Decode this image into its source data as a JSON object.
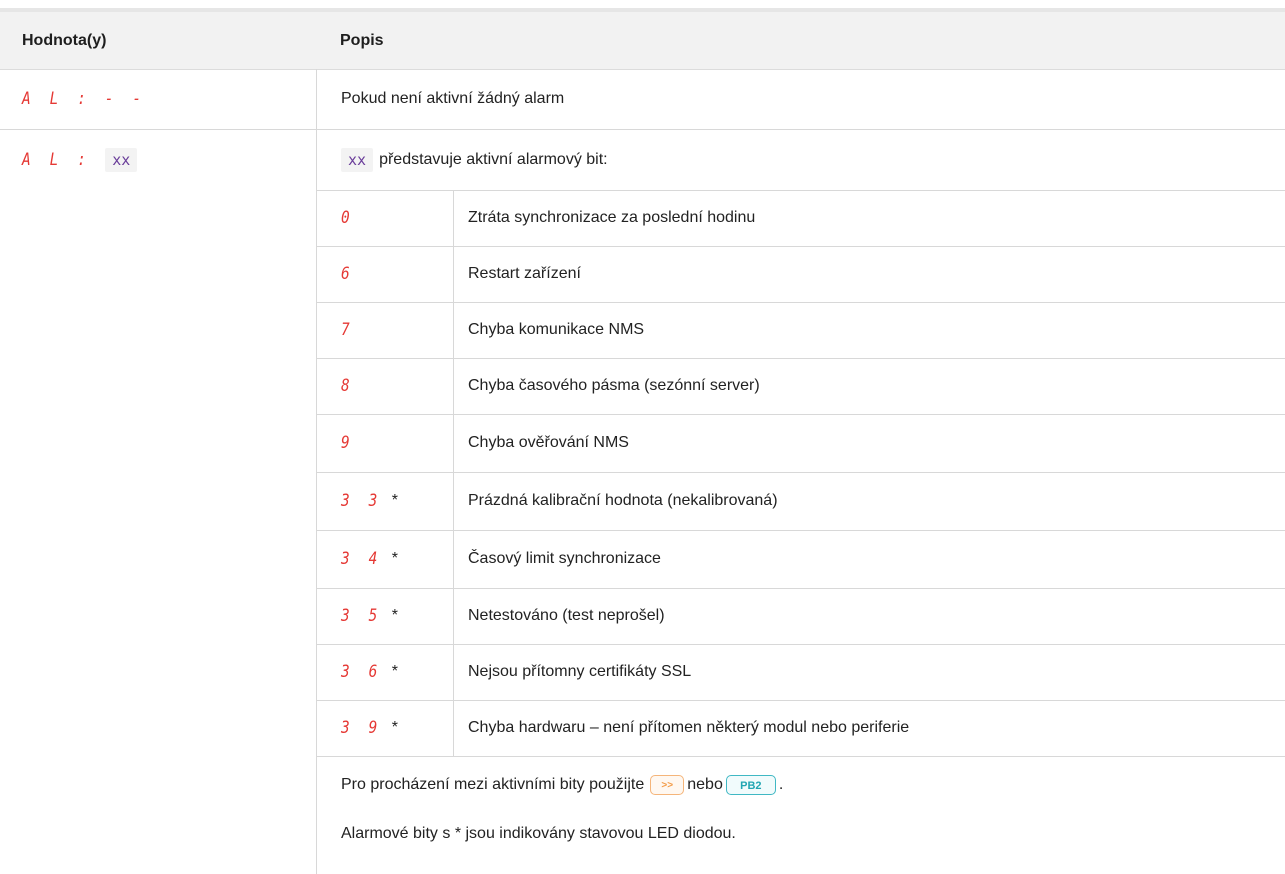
{
  "header": {
    "col1": "Hodnota(y)",
    "col2": "Popis"
  },
  "row_none": {
    "display": "A L : - -",
    "description": "Pokud není aktivní žádný alarm"
  },
  "row_active": {
    "display": "A L :",
    "code": "xx",
    "intro_code": "xx",
    "intro_text": "představuje aktivní alarmový bit:"
  },
  "bits": [
    {
      "code": "0",
      "star": "",
      "description": "Ztráta synchronizace za poslední hodinu"
    },
    {
      "code": "6",
      "star": "",
      "description": "Restart zařízení"
    },
    {
      "code": "7",
      "star": "",
      "description": "Chyba komunikace NMS"
    },
    {
      "code": "8",
      "star": "",
      "description": "Chyba časového pásma (sezónní server)"
    },
    {
      "code": "9",
      "star": "",
      "description": "Chyba ověřování NMS"
    },
    {
      "code": "3 3",
      "star": "*",
      "description": "Prázdná kalibrační hodnota (nekalibrovaná)"
    },
    {
      "code": "3 4",
      "star": "*",
      "description": "Časový limit synchronizace"
    },
    {
      "code": "3 5",
      "star": "*",
      "description": "Netestováno (test neprošel)"
    },
    {
      "code": "3 6",
      "star": "*",
      "description": "Nejsou přítomny certifikáty SSL"
    },
    {
      "code": "3 9",
      "star": "*",
      "description": "Chyba hardwaru – není přítomen některý modul nebo periferie"
    }
  ],
  "footer": {
    "nav_prefix": "Pro procházení mezi aktivními bity použijte",
    "btn_next_label": ">>",
    "nav_or": "nebo",
    "btn_pb2_label": "PB2",
    "nav_suffix": ".",
    "note": "Alarmové bity s * jsou indikovány stavovou LED diodou."
  },
  "colors": {
    "segment": "#e53935",
    "code_text": "#6a3d9a",
    "header_bg": "#f2f2f2",
    "btn_next": "#f39c49",
    "btn_pb2": "#22a6b3"
  }
}
